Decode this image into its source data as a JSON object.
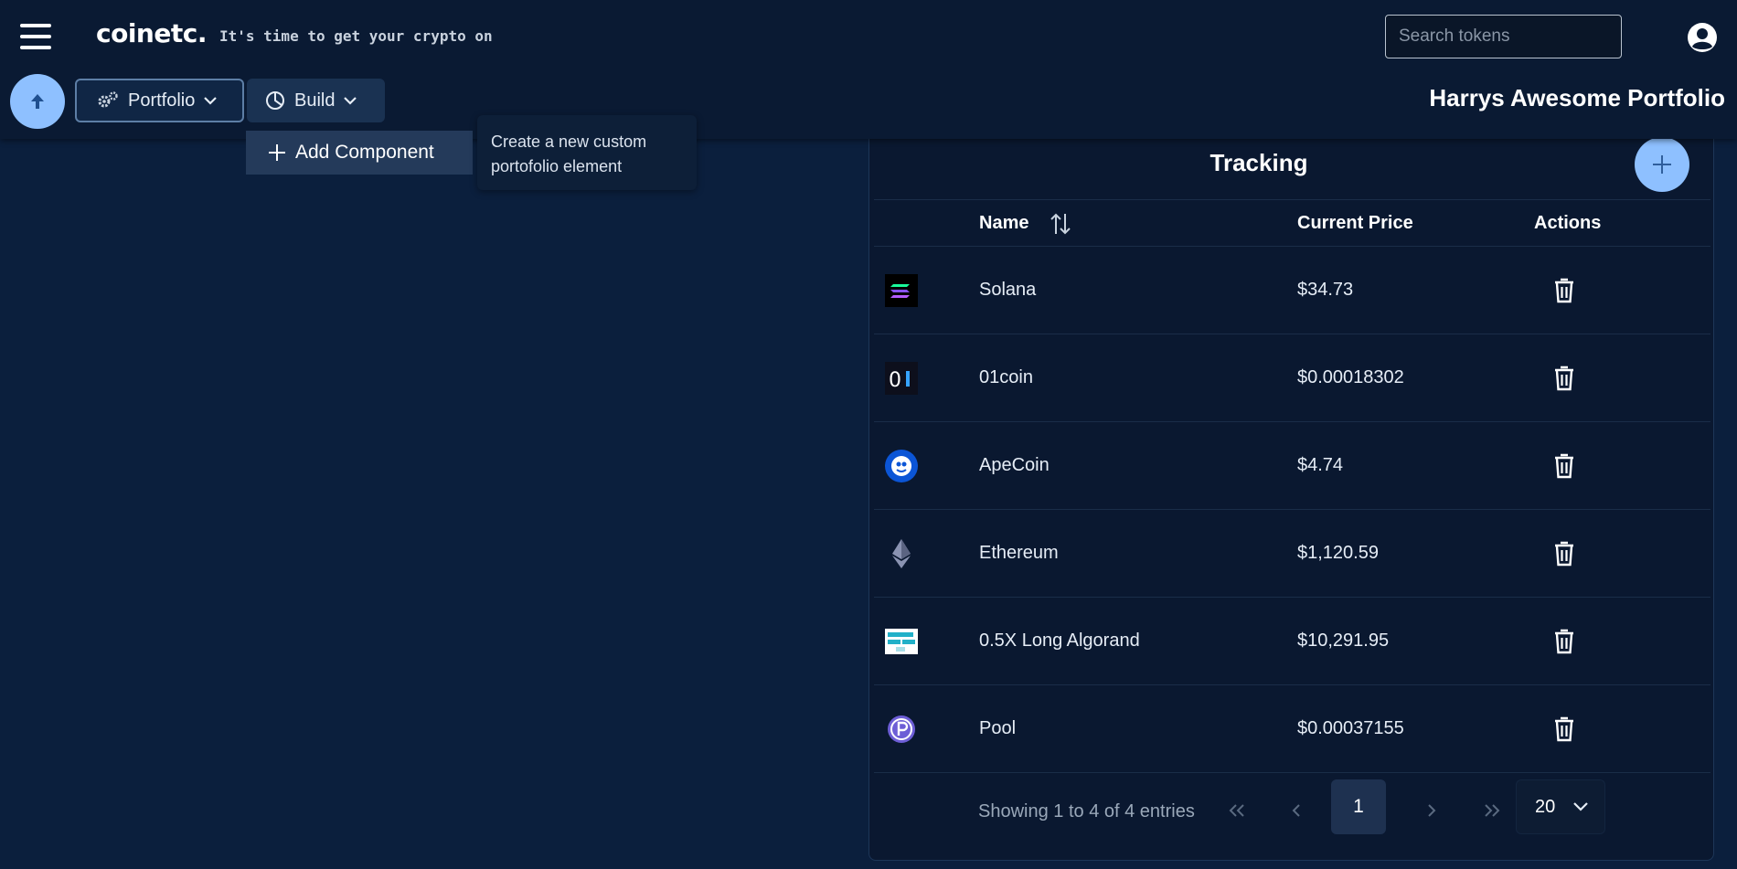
{
  "header": {
    "brand": "coinetc.",
    "tagline": "It's time to get your crypto on",
    "search_placeholder": "Search tokens",
    "portfolio_label": "Portfolio",
    "build_label": "Build",
    "portfolio_title": "Harrys Awesome Portfolio"
  },
  "build_menu": {
    "add_component_label": "Add Component",
    "tooltip": "Create a new custom portofolio element"
  },
  "tracking": {
    "title": "Tracking",
    "columns": {
      "name": "Name",
      "price": "Current Price",
      "actions": "Actions"
    },
    "rows": [
      {
        "name": "Solana",
        "price": "$34.73",
        "icon": "solana-logo"
      },
      {
        "name": "01coin",
        "price": "$0.00018302",
        "icon": "01coin-logo"
      },
      {
        "name": "ApeCoin",
        "price": "$4.74",
        "icon": "apecoin-logo"
      },
      {
        "name": "Ethereum",
        "price": "$1,120.59",
        "icon": "ethereum-logo"
      },
      {
        "name": "0.5X Long Algorand",
        "price": "$10,291.95",
        "icon": "algorand-half-long-logo"
      },
      {
        "name": "Pool",
        "price": "$0.00037155",
        "icon": "pool-logo"
      }
    ],
    "footer": {
      "entries_text": "Showing 1 to 4 of 4 entries",
      "current_page": "1",
      "per_page": "20"
    }
  },
  "colors": {
    "background": "#0b1f3d",
    "header": "#0a1a33",
    "accent_button": "#8ec0ff",
    "card": "#0a1830"
  }
}
